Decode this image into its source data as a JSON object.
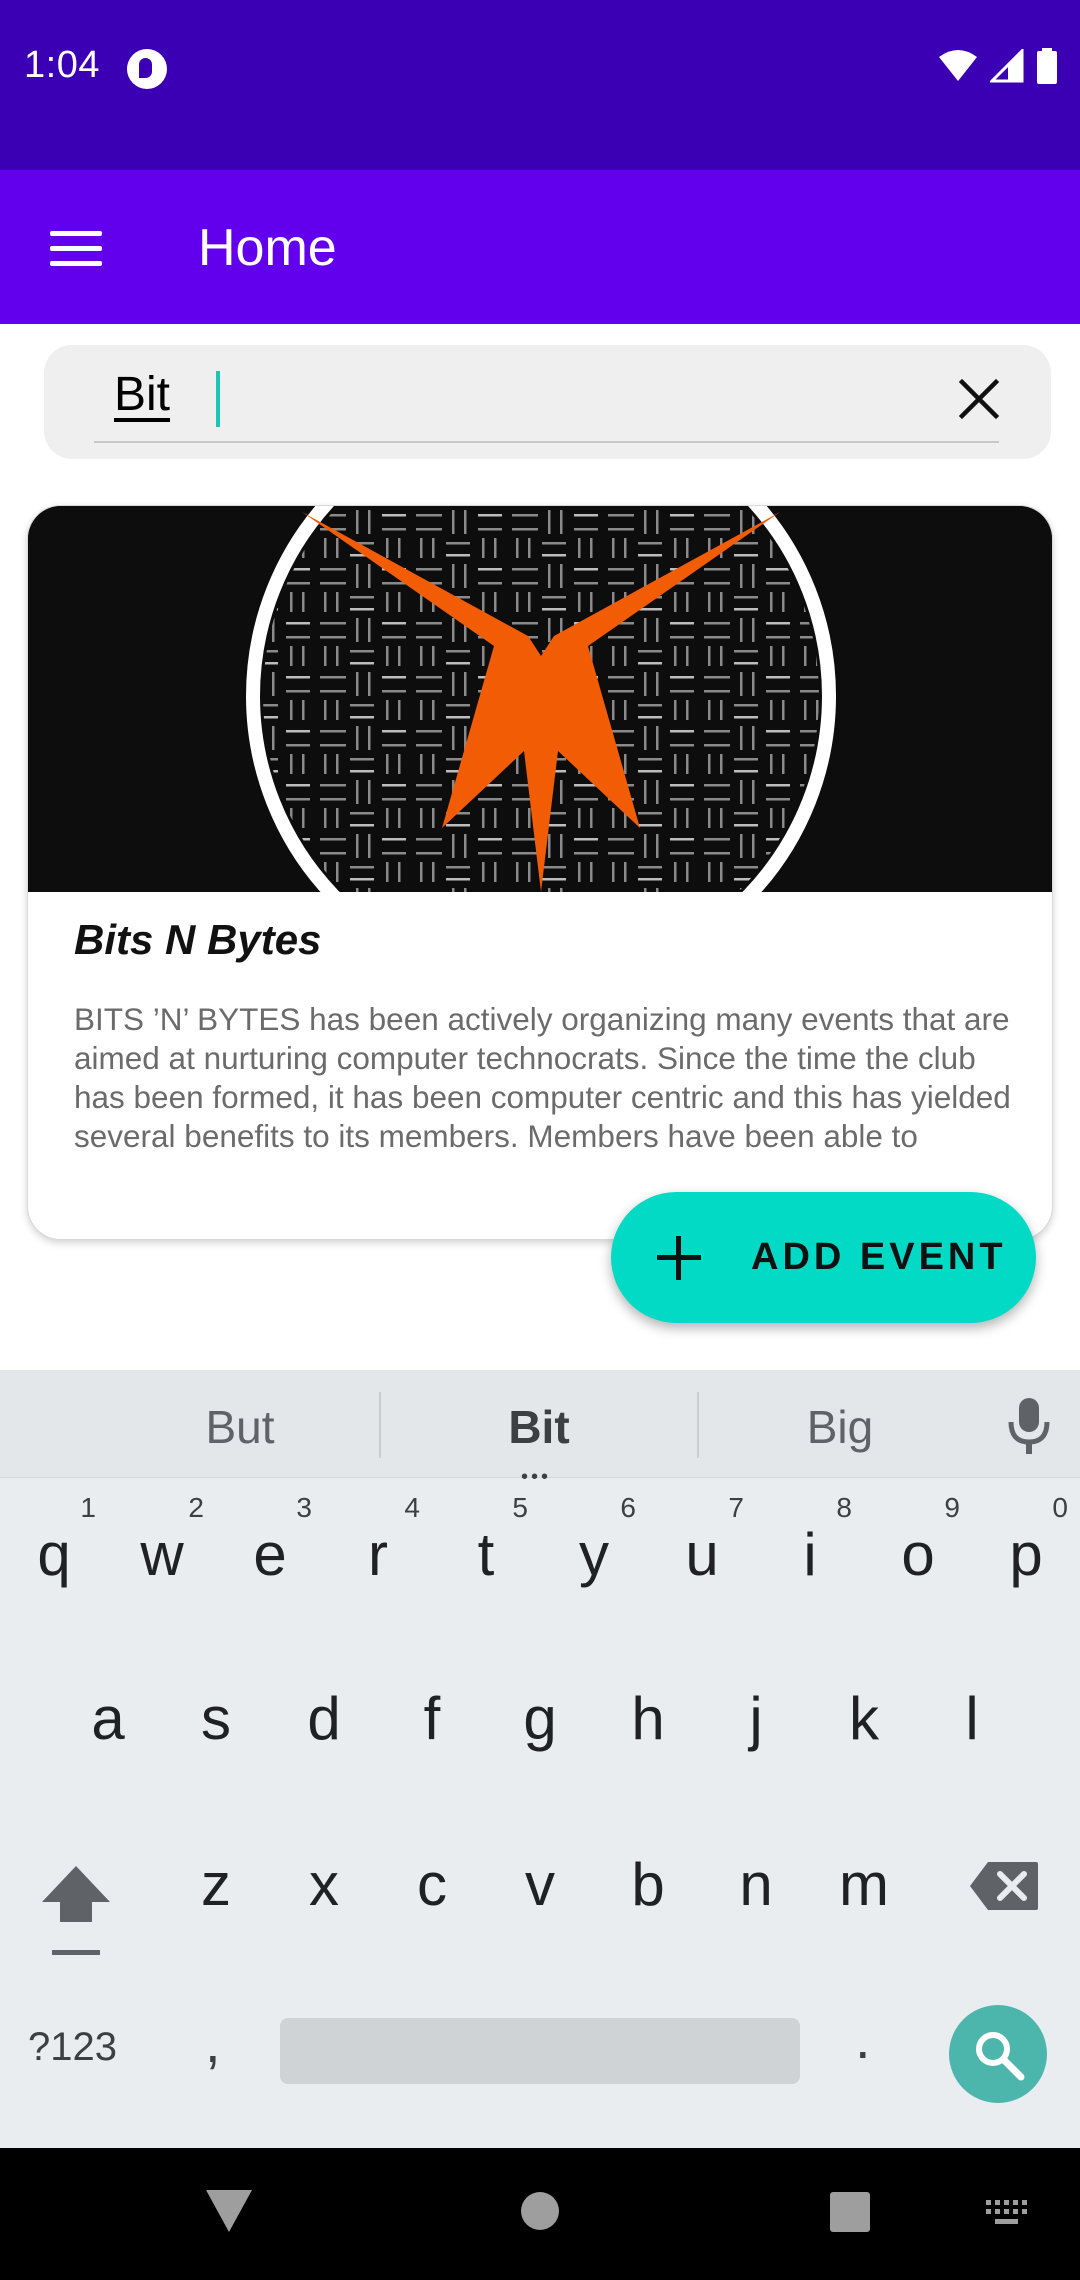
{
  "status_bar": {
    "time": "1:04"
  },
  "app_bar": {
    "title": "Home",
    "menu_icon": "menu-icon"
  },
  "search": {
    "value": "Bit",
    "clear_icon": "close-icon"
  },
  "event_card": {
    "title": "Bits N Bytes",
    "description": "BITS ’N’ BYTES has been actively organizing many events that are aimed at nurturing computer technocrats. Since the time the club has been formed, it has been computer centric and this has yielded several benefits to its members. Members have been able to"
  },
  "fab": {
    "label": "ADD EVENT",
    "icon": "plus-icon"
  },
  "keyboard": {
    "suggestions": [
      "But",
      "Bit",
      "Big"
    ],
    "row1": [
      {
        "ch": "q",
        "hint": "1"
      },
      {
        "ch": "w",
        "hint": "2"
      },
      {
        "ch": "e",
        "hint": "3"
      },
      {
        "ch": "r",
        "hint": "4"
      },
      {
        "ch": "t",
        "hint": "5"
      },
      {
        "ch": "y",
        "hint": "6"
      },
      {
        "ch": "u",
        "hint": "7"
      },
      {
        "ch": "i",
        "hint": "8"
      },
      {
        "ch": "o",
        "hint": "9"
      },
      {
        "ch": "p",
        "hint": "0"
      }
    ],
    "row2": [
      "a",
      "s",
      "d",
      "f",
      "g",
      "h",
      "j",
      "k",
      "l"
    ],
    "row3": [
      "z",
      "x",
      "c",
      "v",
      "b",
      "n",
      "m"
    ],
    "symbols_label": "?123",
    "comma_label": ",",
    "period_label": ".",
    "shift_icon": "shift-icon",
    "backspace_icon": "backspace-icon",
    "search_icon": "search-icon",
    "mic_icon": "mic-icon"
  },
  "colors": {
    "status_bar": "#3b00b3",
    "app_bar": "#6200ee",
    "fab": "#03dac5",
    "logo_orange": "#f25c05",
    "keyboard_bg": "#e9edf0"
  }
}
